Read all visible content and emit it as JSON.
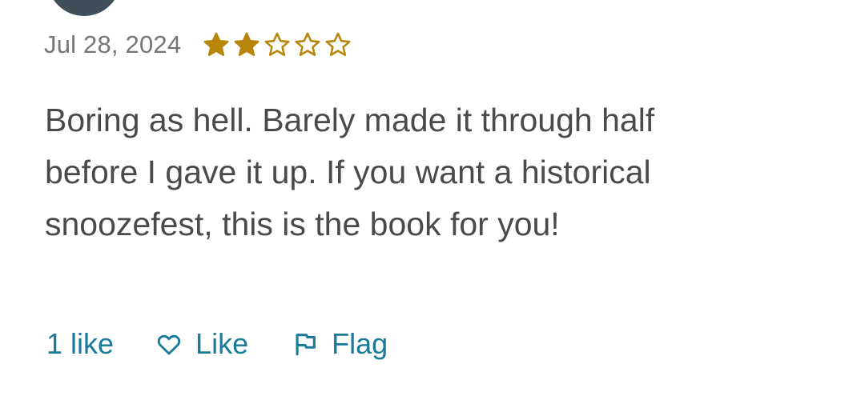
{
  "review": {
    "date": "Jul 28, 2024",
    "rating": 2,
    "rating_max": 5,
    "text": "Boring as hell. Barely made it through half before I gave it up. If you want a historical snoozefest, this is the book for you!"
  },
  "actions": {
    "likes_count": "1 like",
    "like_label": "Like",
    "flag_label": "Flag"
  },
  "icons": {
    "star_filled": "star-filled-icon",
    "star_empty": "star-outline-icon",
    "like": "heart-outline-icon",
    "flag": "flag-outline-icon"
  },
  "colors": {
    "star": "#b8860b",
    "action_link": "#1a7a9a",
    "text": "#4a4a4a",
    "date": "#767676",
    "avatar": "#3f4f5a"
  }
}
